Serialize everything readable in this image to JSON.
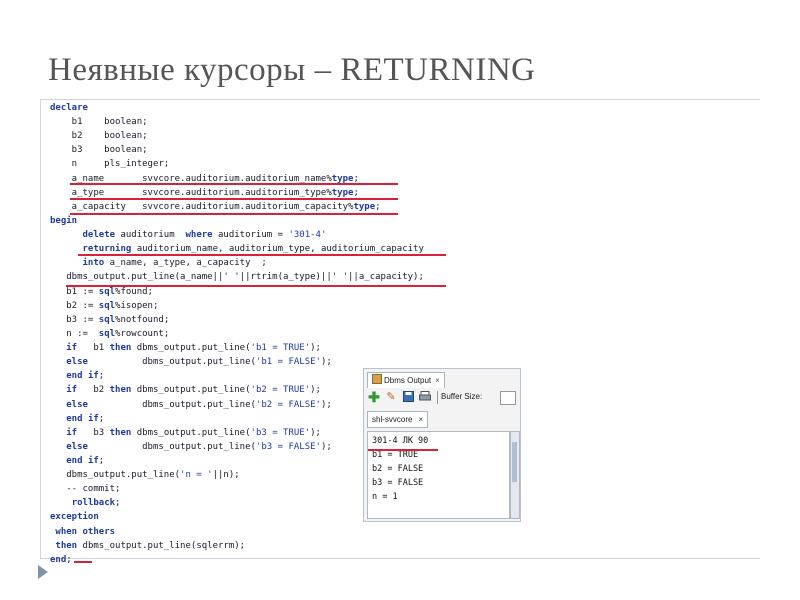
{
  "slide": {
    "title": "Неявные курсоры – RETURNING"
  },
  "code": {
    "lines": [
      [
        [
          "kw",
          "declare"
        ]
      ],
      [
        [
          "t",
          "    b1    boolean;"
        ]
      ],
      [
        [
          "t",
          "    b2    boolean;"
        ]
      ],
      [
        [
          "t",
          "    b3    boolean;"
        ]
      ],
      [
        [
          "t",
          "    n     pls_integer;"
        ]
      ],
      [
        [
          "t",
          "    a_name       svvcore.auditorium.auditorium_name%"
        ],
        [
          "kw",
          "type"
        ],
        [
          "t",
          ";"
        ]
      ],
      [
        [
          "t",
          "    a_type       svvcore.auditorium.auditorium_type%"
        ],
        [
          "kw",
          "type"
        ],
        [
          "t",
          ";"
        ]
      ],
      [
        [
          "t",
          "    a_capacity   svvcore.auditorium.auditorium_capacity%"
        ],
        [
          "kw",
          "type"
        ],
        [
          "t",
          ";"
        ]
      ],
      [
        [
          "kw",
          "begin"
        ]
      ],
      [
        [
          "t",
          "      "
        ],
        [
          "kw",
          "delete"
        ],
        [
          "t",
          " auditorium  "
        ],
        [
          "kw",
          "where"
        ],
        [
          "t",
          " auditorium = "
        ],
        [
          "str",
          "'301-4'"
        ]
      ],
      [
        [
          "t",
          "      "
        ],
        [
          "kw",
          "returning"
        ],
        [
          "t",
          " auditorium_name, auditorium_type, auditorium_capacity"
        ]
      ],
      [
        [
          "t",
          "      "
        ],
        [
          "kw",
          "into"
        ],
        [
          "t",
          " a_name, a_type, a_capacity  ;"
        ]
      ],
      [
        [
          "t",
          "   dbms_output.put_line(a_name||' '||rtrim(a_type)||' '||a_capacity);"
        ]
      ],
      [
        [
          "t",
          "   b1 := "
        ],
        [
          "kw",
          "sql"
        ],
        [
          "t",
          "%found;"
        ]
      ],
      [
        [
          "t",
          "   b2 := "
        ],
        [
          "kw",
          "sql"
        ],
        [
          "t",
          "%isopen;"
        ]
      ],
      [
        [
          "t",
          "   b3 := "
        ],
        [
          "kw",
          "sql"
        ],
        [
          "t",
          "%notfound;"
        ]
      ],
      [
        [
          "t",
          "   n :=  "
        ],
        [
          "kw",
          "sql"
        ],
        [
          "t",
          "%rowcount;"
        ]
      ],
      [
        [
          "t",
          "   "
        ],
        [
          "kw",
          "if"
        ],
        [
          "t",
          "   b1 "
        ],
        [
          "kw",
          "then"
        ],
        [
          "t",
          " dbms_output.put_line("
        ],
        [
          "str",
          "'b1 = TRUE'"
        ],
        [
          "t",
          ");"
        ]
      ],
      [
        [
          "t",
          "   "
        ],
        [
          "kw",
          "else"
        ],
        [
          "t",
          "          dbms_output.put_line("
        ],
        [
          "str",
          "'b1 = FALSE'"
        ],
        [
          "t",
          ");"
        ]
      ],
      [
        [
          "t",
          "   "
        ],
        [
          "kw",
          "end if"
        ],
        [
          "t",
          ";"
        ]
      ],
      [
        [
          "t",
          "   "
        ],
        [
          "kw",
          "if"
        ],
        [
          "t",
          "   b2 "
        ],
        [
          "kw",
          "then"
        ],
        [
          "t",
          " dbms_output.put_line("
        ],
        [
          "str",
          "'b2 = TRUE'"
        ],
        [
          "t",
          ");"
        ]
      ],
      [
        [
          "t",
          "   "
        ],
        [
          "kw",
          "else"
        ],
        [
          "t",
          "          dbms_output.put_line("
        ],
        [
          "str",
          "'b2 = FALSE'"
        ],
        [
          "t",
          ");"
        ]
      ],
      [
        [
          "t",
          "   "
        ],
        [
          "kw",
          "end if"
        ],
        [
          "t",
          ";"
        ]
      ],
      [
        [
          "t",
          "   "
        ],
        [
          "kw",
          "if"
        ],
        [
          "t",
          "   b3 "
        ],
        [
          "kw",
          "then"
        ],
        [
          "t",
          " dbms_output.put_line("
        ],
        [
          "str",
          "'b3 = TRUE'"
        ],
        [
          "t",
          ");"
        ]
      ],
      [
        [
          "t",
          "   "
        ],
        [
          "kw",
          "else"
        ],
        [
          "t",
          "          dbms_output.put_line("
        ],
        [
          "str",
          "'b3 = FALSE'"
        ],
        [
          "t",
          ");"
        ]
      ],
      [
        [
          "t",
          "   "
        ],
        [
          "kw",
          "end if"
        ],
        [
          "t",
          ";"
        ]
      ],
      [
        [
          "t",
          "   dbms_output.put_line("
        ],
        [
          "str",
          "'n = '"
        ],
        [
          "t",
          "||n);"
        ]
      ],
      [
        [
          "t",
          "   -- commit;"
        ]
      ],
      [
        [
          "t",
          "    "
        ],
        [
          "kw",
          "rollback"
        ],
        [
          "t",
          ";"
        ]
      ],
      [
        [
          "kw",
          "exception"
        ]
      ],
      [
        [
          "t",
          " "
        ],
        [
          "kw",
          "when others"
        ]
      ],
      [
        [
          "t",
          " "
        ],
        [
          "kw",
          "then"
        ],
        [
          "t",
          " dbms_output.put_line(sqlerrm);"
        ]
      ],
      [
        [
          "kw",
          "end"
        ],
        [
          "t",
          ";"
        ]
      ]
    ]
  },
  "dbms_output": {
    "tab_label": "Dbms Output",
    "tab_close": "×",
    "buffer_label": "Buffer Size:",
    "connection_tab": "shl-svvcore",
    "connection_close": "×",
    "output_lines": [
      "301-4 ЛК 90",
      "b1 = TRUE",
      "b2 = FALSE",
      "b3 = FALSE",
      "n = 1"
    ]
  },
  "colors": {
    "keyword": "#1d3aa0",
    "underline": "#d9223a",
    "title": "#555555"
  },
  "icons": [
    "add-icon",
    "eraser-icon",
    "save-icon",
    "print-icon"
  ]
}
